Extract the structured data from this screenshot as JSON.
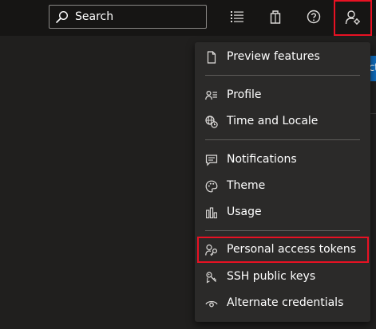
{
  "topbar": {
    "search": {
      "label": "Search",
      "icon": "search-icon"
    },
    "icons": [
      "task-list-icon",
      "shopping-bag-icon",
      "help-icon",
      "user-settings-icon"
    ],
    "peek_text": "ct"
  },
  "menu": {
    "items": [
      {
        "label": "Preview features",
        "icon": "document-icon"
      },
      {
        "label": "Profile",
        "icon": "profile-icon"
      },
      {
        "label": "Time and Locale",
        "icon": "globe-clock-icon"
      },
      {
        "label": "Notifications",
        "icon": "chat-icon"
      },
      {
        "label": "Theme",
        "icon": "palette-icon"
      },
      {
        "label": "Usage",
        "icon": "bar-chart-icon"
      },
      {
        "label": "Personal access tokens",
        "icon": "person-key-icon"
      },
      {
        "label": "SSH public keys",
        "icon": "keys-icon"
      },
      {
        "label": "Alternate credentials",
        "icon": "eye-icon"
      }
    ]
  },
  "colors": {
    "background": "#201f1e",
    "topbar": "#161514",
    "menu": "#2b2a29",
    "highlight": "#e81123",
    "accent": "#0f6cbd"
  }
}
